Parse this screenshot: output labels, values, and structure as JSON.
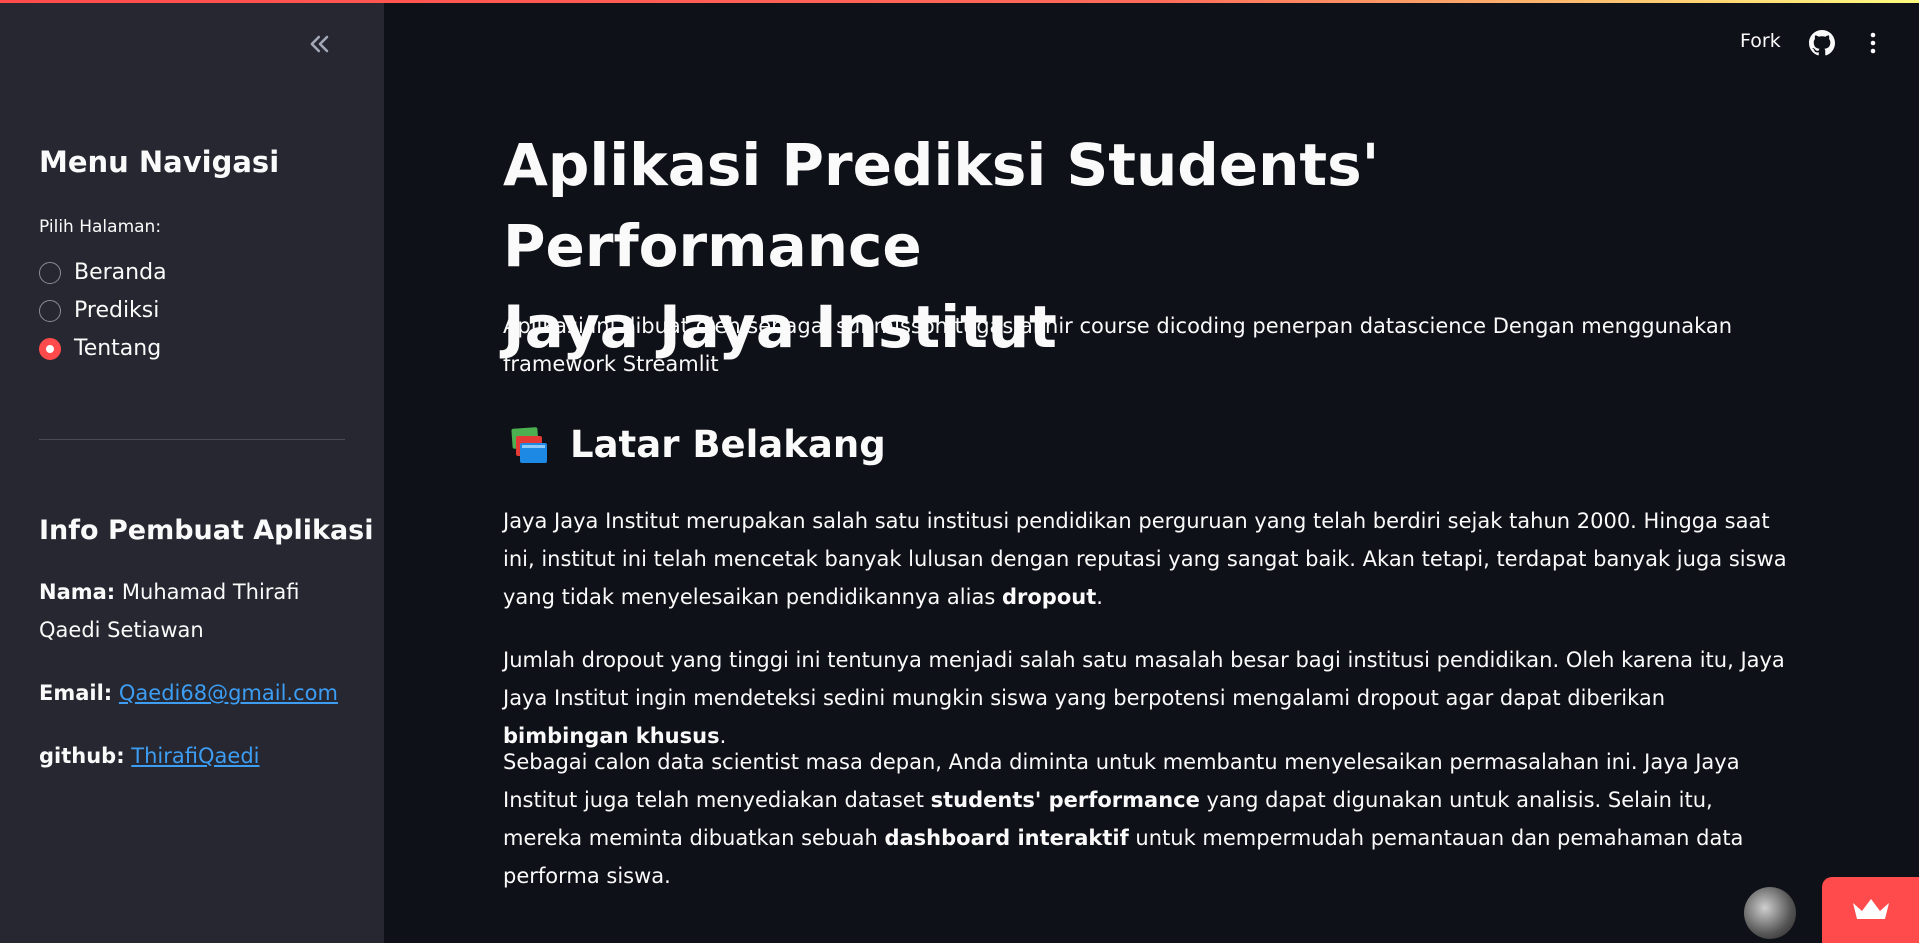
{
  "sidebar": {
    "menu_heading": "Menu Navigasi",
    "radio_label": "Pilih Halaman:",
    "options": [
      "Beranda",
      "Prediksi",
      "Tentang"
    ],
    "selected": "Tentang",
    "info_heading": "Info Pembuat Aplikasi",
    "name_label": "Nama:",
    "name_value_1": "Muhamad Thirafi",
    "name_value_2": "Qaedi Setiawan",
    "email_label": "Email:",
    "email_value": "Qaedi68@gmail.com",
    "github_label": "github:",
    "github_value": "ThirafiQaedi"
  },
  "header": {
    "fork_label": "Fork"
  },
  "main": {
    "title_line1": "Aplikasi Prediksi Students' Performance",
    "title_line2": "Jaya Jaya Institut",
    "intro": "Aplikasi ini dibuat oleh sebagai submisson tugas akhir course dicoding penerpan datascience Dengan menggunakan framework Streamlit",
    "section_heading": "Latar Belakang",
    "p1_a": "Jaya Jaya Institut merupakan salah satu institusi pendidikan perguruan yang telah berdiri sejak tahun 2000. Hingga saat ini, institut ini telah mencetak banyak lulusan dengan reputasi yang sangat baik. Akan tetapi, terdapat banyak juga siswa yang tidak menyelesaikan pendidikannya alias ",
    "p1_b": "dropout",
    "p1_c": ".",
    "p2_a": "Jumlah dropout yang tinggi ini tentunya menjadi salah satu masalah besar bagi institusi pendidikan. Oleh karena itu, Jaya Jaya Institut ingin mendeteksi sedini mungkin siswa yang berpotensi mengalami dropout agar dapat diberikan ",
    "p2_b": "bimbingan khusus",
    "p2_c": ".",
    "p3_a": "Sebagai calon data scientist masa depan, Anda diminta untuk membantu menyelesaikan permasalahan ini. Jaya Jaya Institut juga telah menyediakan dataset ",
    "p3_b": "students' performance",
    "p3_c": " yang dapat digunakan untuk analisis. Selain itu, mereka meminta dibuatkan sebuah ",
    "p3_d": "dashboard interaktif",
    "p3_e": " untuk mempermudah pemantauan dan pemahaman data performa siswa."
  },
  "colors": {
    "background": "#0e1117",
    "sidebar": "#262730",
    "accent": "#ff4b4b",
    "link": "#3d9df3"
  }
}
